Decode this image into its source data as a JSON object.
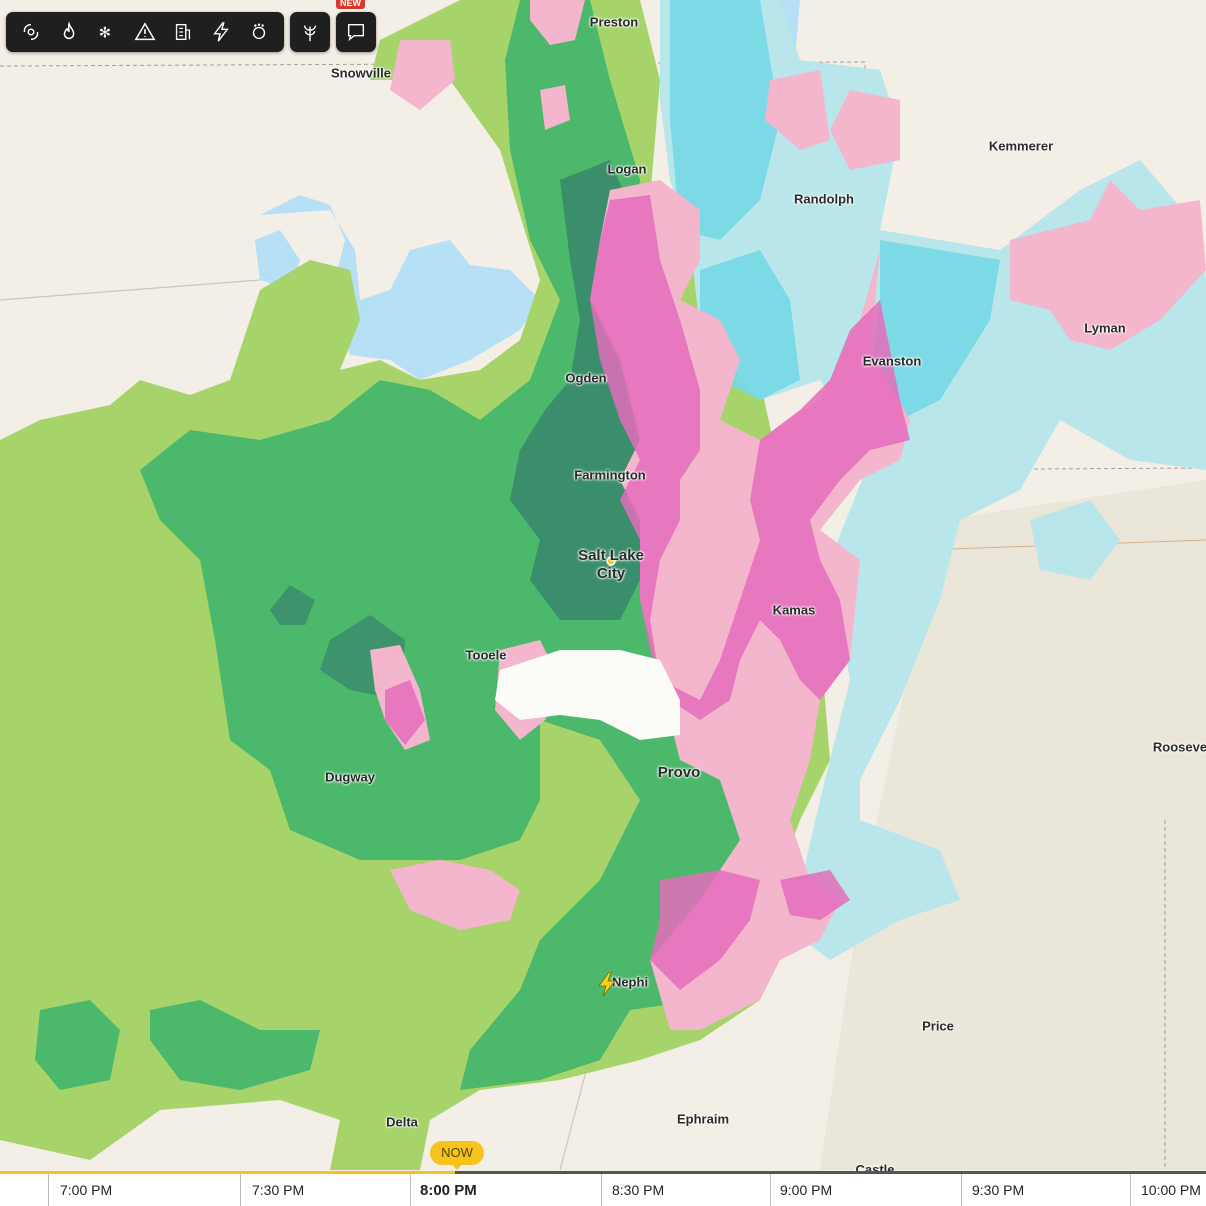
{
  "toolbar": {
    "buttons": [
      {
        "icon": "hurricane-icon",
        "label": "Hurricanes"
      },
      {
        "icon": "fire-icon",
        "label": "Wildfires"
      },
      {
        "icon": "snowflake-icon",
        "label": "Winter weather"
      },
      {
        "icon": "warning-icon",
        "label": "Alerts"
      },
      {
        "icon": "building-icon",
        "label": "Air quality"
      },
      {
        "icon": "lightning-icon",
        "label": "Lightning"
      },
      {
        "icon": "pollen-icon",
        "label": "Pollen"
      }
    ],
    "extra_button": {
      "icon": "plant-icon",
      "label": "Allergy"
    },
    "chat_button": {
      "icon": "chat-icon",
      "label": "Feedback"
    },
    "new_badge": "NEW"
  },
  "colors": {
    "rain_light": "#a6d36a",
    "rain_moderate": "#4bb86b",
    "rain_heavy": "#3a8a6c",
    "mix_light": "#f4b6cc",
    "mix_heavy": "#e46cbb",
    "snow_light": "#b9e6ea",
    "snow_moderate": "#76d8e6",
    "water": "#b5e0f5",
    "toolbar_bg": "#1f1f1f",
    "timeline_accent": "#f6c21c"
  },
  "cities": [
    {
      "name": "Preston"
    },
    {
      "name": "Snowville"
    },
    {
      "name": "Logan"
    },
    {
      "name": "Kemmerer"
    },
    {
      "name": "Randolph"
    },
    {
      "name": "Lyman"
    },
    {
      "name": "Evanston"
    },
    {
      "name": "Ogden"
    },
    {
      "name": "Farmington"
    },
    {
      "name": "Salt Lake\nCity"
    },
    {
      "name": "Kamas"
    },
    {
      "name": "Tooele"
    },
    {
      "name": "Dugway"
    },
    {
      "name": "Provo"
    },
    {
      "name": "Rooseve"
    },
    {
      "name": "Nephi"
    },
    {
      "name": "Price"
    },
    {
      "name": "Ephraim"
    },
    {
      "name": "Delta"
    },
    {
      "name": "Castle\nDale"
    }
  ],
  "timeline": {
    "now_label": "NOW",
    "ticks": [
      "7:00 PM",
      "7:30 PM",
      "8:00 PM",
      "8:30 PM",
      "9:00 PM",
      "9:30 PM",
      "10:00 PM"
    ],
    "current": "8:00 PM",
    "progress": 0.377
  }
}
